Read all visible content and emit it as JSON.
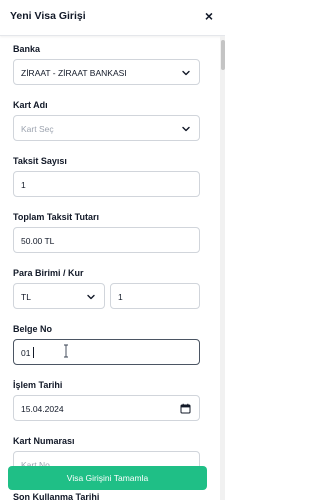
{
  "header": {
    "title": "Yeni Visa Girişi",
    "close_label": "×"
  },
  "form": {
    "banka": {
      "label": "Banka",
      "value": "ZİRAAT - ZİRAAT BANKASI"
    },
    "kart_adi": {
      "label": "Kart Adı",
      "placeholder": "Kart Seç"
    },
    "taksit_sayisi": {
      "label": "Taksit Sayısı",
      "value": "1"
    },
    "toplam_taksit_tutari": {
      "label": "Toplam Taksit Tutarı",
      "value": "50.00 TL"
    },
    "para_birimi_kur": {
      "label": "Para Birimi / Kur",
      "currency": "TL",
      "rate": "1"
    },
    "belge_no": {
      "label": "Belge No",
      "value": "01"
    },
    "islem_tarihi": {
      "label": "İşlem Tarihi",
      "value": "15.04.2024"
    },
    "kart_numarasi": {
      "label": "Kart Numarası",
      "placeholder": "Kart No"
    },
    "son_kullanma_tarihi": {
      "label": "Son Kullanma Tarihi"
    }
  },
  "submit_button": {
    "label": "Visa Girişini Tamamla"
  },
  "colors": {
    "primary": "#1fbf86",
    "border": "#d1d5db",
    "text": "#111827",
    "placeholder": "#9ca3af"
  }
}
